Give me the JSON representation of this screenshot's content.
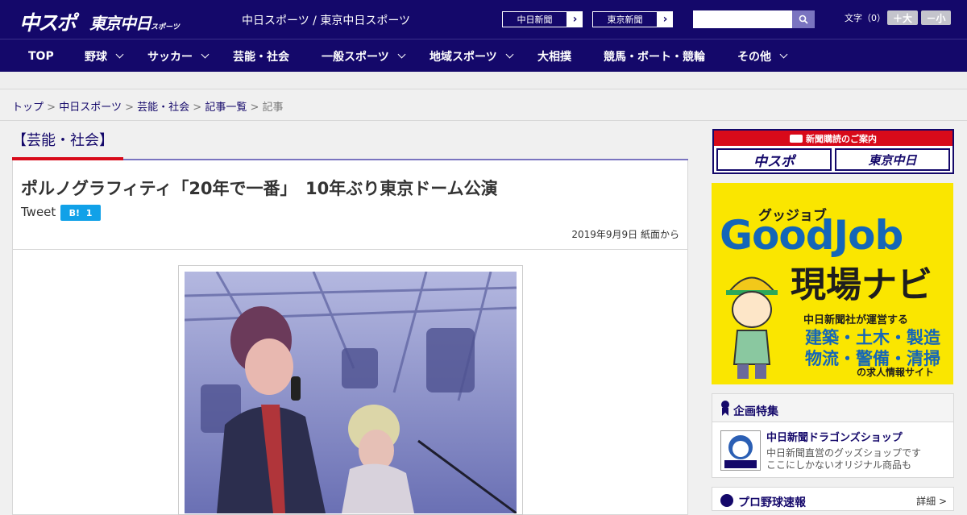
{
  "header": {
    "logo_chuspo": "中スポ",
    "logo_tokyo": "東京中日",
    "logo_tokyo_small": "スポーツ",
    "site_links": "中日スポーツ / 東京中日スポーツ",
    "btn_chunichi": "中日新聞",
    "btn_tokyo": "東京新聞",
    "search_placeholder": "",
    "font_label": "文字（0）",
    "font_larger": "＋大",
    "font_smaller": "－小"
  },
  "nav": {
    "items": [
      "TOP",
      "野球",
      "サッカー",
      "芸能・社会",
      "一般スポーツ",
      "地域スポーツ",
      "大相撲",
      "競馬・ボート・競輪",
      "その他"
    ]
  },
  "breadcrumb": {
    "items": [
      "トップ",
      "中日スポーツ",
      "芸能・社会",
      "記事一覧"
    ],
    "current": "記事",
    "separator": ">"
  },
  "article": {
    "section": "【芸能・社会】",
    "headline": "ポルノグラフィティ「20年で一番」　10年ぶり東京ドーム公演",
    "tweet": "Tweet",
    "hatena_label": "B!",
    "hatena_count": "1",
    "date": "2019年9月9日 紙面から"
  },
  "sidebar": {
    "subscribe_head": "新聞購読のご案内",
    "subscribe_logo_1": "中スポ",
    "subscribe_logo_2": "東京中日",
    "ad": {
      "sub": "グッジョブ",
      "main": "GoodJob",
      "navi": "現場ナビ",
      "small": "中日新聞社が運営する",
      "line1": "建築・土木・製造",
      "line2": "物流・警備・清掃",
      "foot": "の求人情報サイト"
    },
    "feature": {
      "title": "企画特集",
      "name": "中日新聞ドラゴンズショップ",
      "desc1": "中日新聞直営のグッズショップです",
      "desc2": "ここにしかないオリジナル商品も"
    },
    "score": {
      "title": "プロ野球速報",
      "more": "詳細 >"
    }
  },
  "colors": {
    "brand_navy": "#14086a",
    "accent_red": "#d80a1a",
    "accent_purple": "#7a74c0"
  }
}
